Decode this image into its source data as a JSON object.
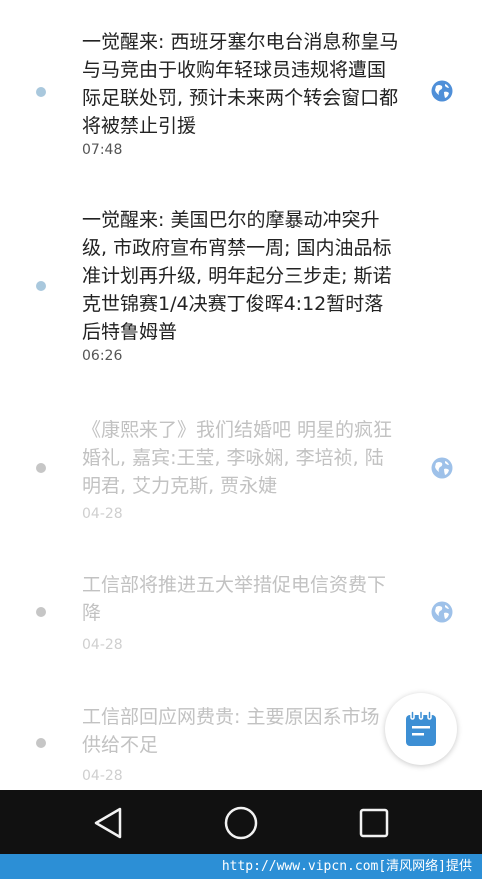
{
  "feed": {
    "items": [
      {
        "title": "一觉醒来: 西班牙塞尔电台消息称皇马与马竞由于收购年轻球员违规将遭国际足联处罚, 预计未来两个转会窗口都将被禁止引援",
        "time": "07:48",
        "read": false,
        "globe": true
      },
      {
        "title": "一觉醒来: 美国巴尔的摩暴动冲突升级, 市政府宣布宵禁一周; 国内油品标准计划再升级, 明年起分三步走; 斯诺克世锦赛1/4决赛丁俊晖4:12暂时落后特鲁姆普",
        "time": "06:26",
        "read": false,
        "globe": false
      },
      {
        "title": "《康熙来了》我们结婚吧 明星的疯狂婚礼, 嘉宾:王莹, 李咏娴, 李培祯, 陆明君, 艾力克斯, 贾永婕",
        "time": "04-28",
        "read": true,
        "globe": true
      },
      {
        "title": "工信部将推进五大举措促电信资费下降",
        "time": "04-28",
        "read": true,
        "globe": true
      },
      {
        "title": "工信部回应网费贵: 主要原因系市场供给不足",
        "time": "04-28",
        "read": true,
        "globe": false
      }
    ]
  },
  "icons": {
    "globe": "globe-icon",
    "fab": "notepad-icon",
    "back": "back-triangle-icon",
    "home": "home-circle-icon",
    "recents": "recents-square-icon"
  },
  "colors": {
    "accent": "#4f8fd8",
    "footer_bg": "#2c8fd6",
    "navbar_bg": "#111111"
  },
  "footer": {
    "watermark": "http://www.vipcn.com[清风网络]提供"
  }
}
